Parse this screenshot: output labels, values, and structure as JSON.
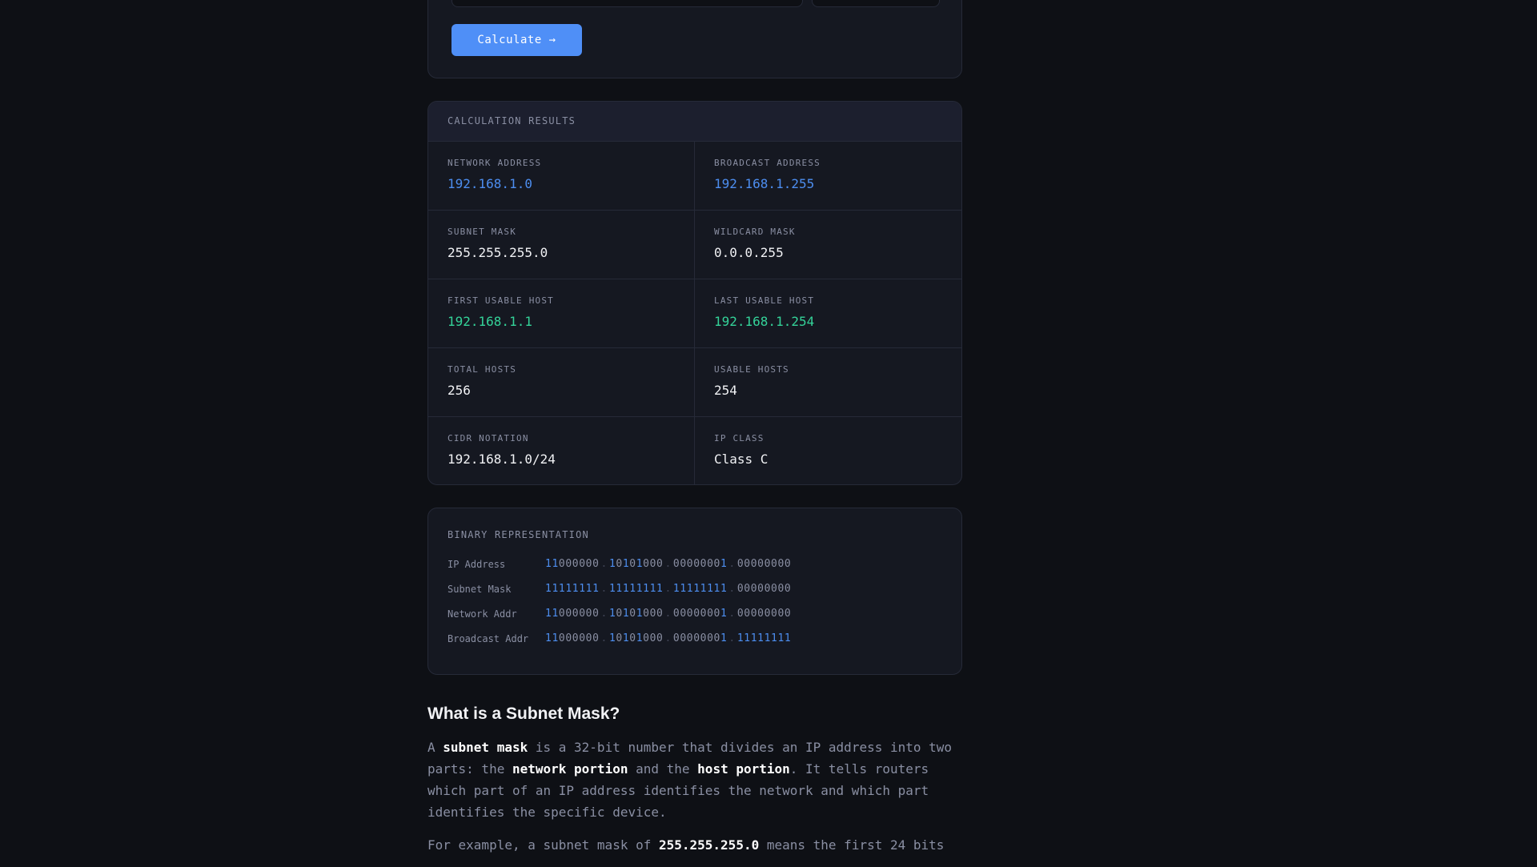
{
  "form": {
    "calculate_label": "Calculate →"
  },
  "results": {
    "title": "CALCULATION RESULTS",
    "items": [
      {
        "label": "NETWORK ADDRESS",
        "value": "192.168.1.0",
        "color": "blue"
      },
      {
        "label": "BROADCAST ADDRESS",
        "value": "192.168.1.255",
        "color": "blue"
      },
      {
        "label": "SUBNET MASK",
        "value": "255.255.255.0",
        "color": ""
      },
      {
        "label": "WILDCARD MASK",
        "value": "0.0.0.255",
        "color": ""
      },
      {
        "label": "FIRST USABLE HOST",
        "value": "192.168.1.1",
        "color": "green"
      },
      {
        "label": "LAST USABLE HOST",
        "value": "192.168.1.254",
        "color": "green"
      },
      {
        "label": "TOTAL HOSTS",
        "value": "256",
        "color": ""
      },
      {
        "label": "USABLE HOSTS",
        "value": "254",
        "color": ""
      },
      {
        "label": "CIDR NOTATION",
        "value": "192.168.1.0/24",
        "color": ""
      },
      {
        "label": "IP CLASS",
        "value": "Class C",
        "color": ""
      }
    ]
  },
  "binary": {
    "title": "BINARY REPRESENTATION",
    "rows": [
      {
        "label": "IP Address",
        "octets": [
          "11000000",
          "10101000",
          "00000001",
          "00000000"
        ]
      },
      {
        "label": "Subnet Mask",
        "octets": [
          "11111111",
          "11111111",
          "11111111",
          "00000000"
        ]
      },
      {
        "label": "Network Addr",
        "octets": [
          "11000000",
          "10101000",
          "00000001",
          "00000000"
        ]
      },
      {
        "label": "Broadcast Addr",
        "octets": [
          "11000000",
          "10101000",
          "00000001",
          "11111111"
        ]
      }
    ]
  },
  "info": {
    "heading": "What is a Subnet Mask?",
    "p1": [
      [
        "A ",
        false
      ],
      [
        "subnet mask",
        true
      ],
      [
        " is a 32-bit number that divides an IP address into two parts: the ",
        false
      ],
      [
        "network portion",
        true
      ],
      [
        " and the ",
        false
      ],
      [
        "host portion",
        true
      ],
      [
        ". It tells routers which part of an IP address identifies the network and which part identifies the specific device.",
        false
      ]
    ],
    "p2": [
      [
        "For example, a subnet mask of ",
        false
      ],
      [
        "255.255.255.0",
        true
      ],
      [
        " means the first 24 bits",
        false
      ]
    ]
  },
  "colors": {
    "accent": "#4f8ff7",
    "blue": "#4d8ef0",
    "green": "#34d399",
    "background": "#0e1015"
  }
}
